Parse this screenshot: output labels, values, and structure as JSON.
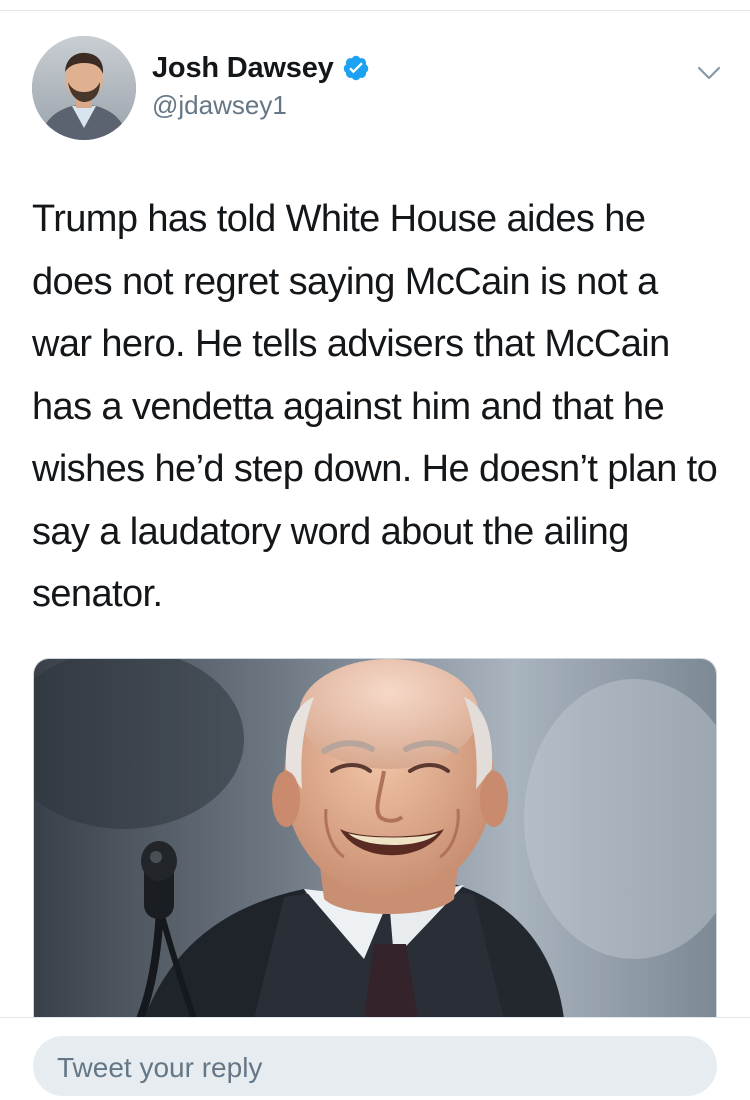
{
  "tweet": {
    "author": {
      "display_name": "Josh Dawsey",
      "handle": "@jdawsey1",
      "verified": true,
      "avatar_icon": "profile-photo"
    },
    "text": "Trump has told White House aides he does not regret saying McCain is not a war hero. He tells advisers that McCain has a vendetta against him and that he wishes he’d step down. He doesn’t plan to say a laudatory word about the ailing senator.",
    "media": {
      "kind": "photo"
    },
    "more_icon": "chevron-down-icon"
  },
  "reply": {
    "placeholder": "Tweet your reply"
  },
  "colors": {
    "verified_blue": "#1da1f2",
    "secondary_text": "#657786",
    "primary_text": "#14171a",
    "reply_background": "#e6ecf0"
  }
}
